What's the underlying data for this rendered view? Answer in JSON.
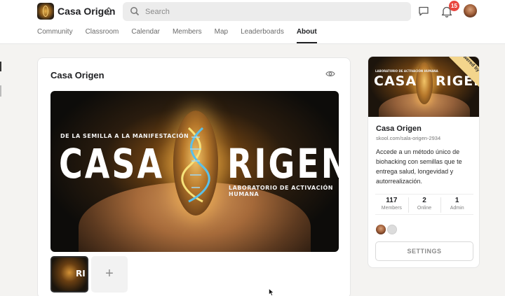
{
  "header": {
    "community_name": "Casa Origen",
    "search_placeholder": "Search",
    "notification_count": "15"
  },
  "nav": {
    "tabs": [
      {
        "label": "Community"
      },
      {
        "label": "Classroom"
      },
      {
        "label": "Calendar"
      },
      {
        "label": "Members"
      },
      {
        "label": "Map"
      },
      {
        "label": "Leaderboards"
      },
      {
        "label": "About",
        "active": true
      }
    ]
  },
  "main": {
    "title": "Casa Origen",
    "hero": {
      "tagline_top": "DE LA SEMILLA A LA MANIFESTACIÓN",
      "word_left": "CASA",
      "word_right": "RIGEN",
      "tagline_bottom": "LABORATORIO DE ACTIVACIÓN HUMANA"
    },
    "thumb_word": "RI",
    "add_media_label": "+"
  },
  "sidebar": {
    "banner_word_left": "CASA",
    "banner_word_right": "RIGEN",
    "banner_tagline_top": "LABORATORIO DE ACTIVACIÓN HUMANA",
    "powered_by": "Powered by skool",
    "title": "Casa Origen",
    "url": "skool.com/sala-origen-2934",
    "description": "Accede a un método único de biohacking con semillas que te entrega salud, longevidad y autorrealización.",
    "stats": [
      {
        "value": "117",
        "label": "Members"
      },
      {
        "value": "2",
        "label": "Online"
      },
      {
        "value": "1",
        "label": "Admin"
      }
    ],
    "settings_label": "SETTINGS"
  },
  "colors": {
    "accent_text": "#202124",
    "badge": "#e9463f",
    "hero_glow": "#c9892e",
    "powered_badge": "#f3d58c"
  }
}
